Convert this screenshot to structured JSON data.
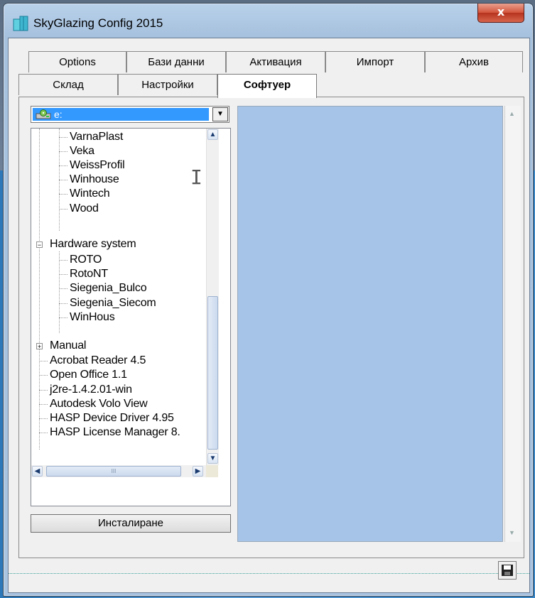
{
  "window": {
    "title": "SkyGlazing Config 2015",
    "close_label": "x"
  },
  "tabs_row_top": [
    "Options",
    "Бази данни",
    "Активация",
    "Импорт",
    "Архив"
  ],
  "tabs_row_bottom": [
    "Склад",
    "Настройки",
    "Софтуер"
  ],
  "active_tab": "Софтуер",
  "drive_select": {
    "value": "e:",
    "icon": "drive-icon"
  },
  "tree": {
    "items": [
      {
        "label": "VarnaPlast",
        "level": 2
      },
      {
        "label": "Veka",
        "level": 2
      },
      {
        "label": "WeissProfil",
        "level": 2
      },
      {
        "label": "Winhouse",
        "level": 2
      },
      {
        "label": "Wintech",
        "level": 2
      },
      {
        "label": "Wood",
        "level": 2
      },
      {
        "label": "Hardware system",
        "level": 1,
        "expanded": true
      },
      {
        "label": "ROTO",
        "level": 2
      },
      {
        "label": "RotoNT",
        "level": 2
      },
      {
        "label": "Siegenia_Bulco",
        "level": 2
      },
      {
        "label": "Siegenia_Siecom",
        "level": 2
      },
      {
        "label": "WinHous",
        "level": 2
      },
      {
        "label": "Manual",
        "level": 1,
        "expanded": false
      },
      {
        "label": "Acrobat Reader 4.5",
        "level": 1
      },
      {
        "label": "Open Office 1.1",
        "level": 1
      },
      {
        "label": "j2re-1.4.2.01-win",
        "level": 1
      },
      {
        "label": "Autodesk Volo View",
        "level": 1
      },
      {
        "label": "HASP Device Driver 4.95",
        "level": 1
      },
      {
        "label": "HASP License Manager 8.",
        "level": 1
      }
    ],
    "hscroll_grip": "III"
  },
  "buttons": {
    "install": "Инсталиране"
  },
  "colors": {
    "text_panel_bg": "#a5c4e8",
    "selection": "#3399ff",
    "close_red": "#c7452c"
  }
}
